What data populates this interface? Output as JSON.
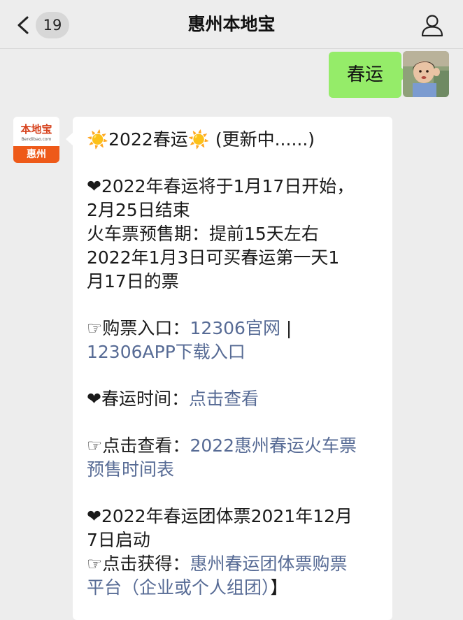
{
  "navbar": {
    "title": "惠州本地宝",
    "unread_count": "19",
    "back_icon": "chevron-left-icon",
    "profile_icon": "person-icon"
  },
  "messages": {
    "outgoing": {
      "text": "春运"
    },
    "avatar_logo": {
      "brand": "本地宝",
      "sub": "Bendibao.com",
      "city": "惠州"
    },
    "incoming": {
      "title_prefix": "☀️",
      "title": "2022春运",
      "title_suffix": "☀️",
      "title_note": " (更新中......)",
      "heart": "❤",
      "point": "☞",
      "p1_line1": "2022年春运将于1月17日开始，",
      "p1_line2": "2月25日结束",
      "p1_line3": "火车票预售期：提前15天左右",
      "p1_line4": "2022年1月3日可买春运第一天1",
      "p1_line5": "月17日的票",
      "p2_label": "购票入口：",
      "p2_link1": "12306官网",
      "p2_sep": " |",
      "p2_link2": "12306APP下载入口",
      "p3_label": "春运时间：",
      "p3_link": "点击查看",
      "p4_label": "点击查看：",
      "p4_link_line1": "2022惠州春运火车票",
      "p4_link_line2": "预售时间表",
      "p5_line1": "2022年春运团体票2021年12月",
      "p5_line2": "7日启动",
      "p6_label": "点击获得：",
      "p6_link_line1": "惠州春运团体票购票",
      "p6_link_line2": "平台（企业或个人组团）",
      "p6_close": "】"
    }
  },
  "colors": {
    "bubble_out": "#95ec69",
    "link": "#576b95",
    "background": "#ededed"
  }
}
